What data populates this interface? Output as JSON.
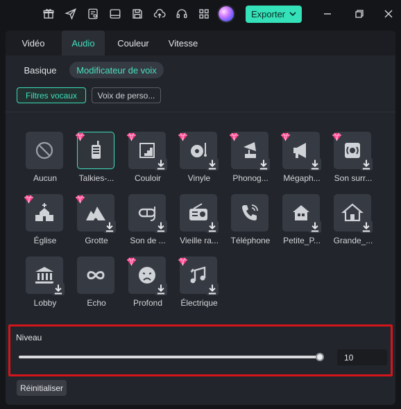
{
  "topbar": {
    "icons": [
      "gift-icon",
      "send-icon",
      "checklist-icon",
      "layout-icon",
      "save-icon",
      "cloud-upload-icon",
      "headset-icon",
      "grid-icon"
    ],
    "export_label": "Exporter"
  },
  "tabs": [
    {
      "label": "Vidéo",
      "active": false
    },
    {
      "label": "Audio",
      "active": true
    },
    {
      "label": "Couleur",
      "active": false
    },
    {
      "label": "Vitesse",
      "active": false
    }
  ],
  "subtabs": [
    {
      "label": "Basique",
      "active": false
    },
    {
      "label": "Modificateur de voix",
      "active": true
    }
  ],
  "chips": [
    {
      "label": "Filtres vocaux",
      "active": true
    },
    {
      "label": "Voix de perso...",
      "active": false
    }
  ],
  "effects": [
    {
      "label": "Aucun",
      "icon": "none-icon",
      "premium": false,
      "download": false,
      "selected": false
    },
    {
      "label": "Talkies-...",
      "icon": "walkie-talkie-icon",
      "premium": true,
      "download": false,
      "selected": true
    },
    {
      "label": "Couloir",
      "icon": "stairs-icon",
      "premium": true,
      "download": true,
      "selected": false
    },
    {
      "label": "Vinyle",
      "icon": "turntable-icon",
      "premium": true,
      "download": true,
      "selected": false
    },
    {
      "label": "Phonog...",
      "icon": "phonograph-icon",
      "premium": true,
      "download": true,
      "selected": false
    },
    {
      "label": "Mégaph...",
      "icon": "megaphone-icon",
      "premium": true,
      "download": true,
      "selected": false
    },
    {
      "label": "Son surr...",
      "icon": "surround-speaker-icon",
      "premium": true,
      "download": true,
      "selected": false
    },
    {
      "label": "Église",
      "icon": "church-icon",
      "premium": true,
      "download": false,
      "selected": false
    },
    {
      "label": "Grotte",
      "icon": "cave-icon",
      "premium": true,
      "download": true,
      "selected": false
    },
    {
      "label": "Son de ...",
      "icon": "diving-mask-icon",
      "premium": false,
      "download": true,
      "selected": false
    },
    {
      "label": "Vieille ra...",
      "icon": "old-radio-icon",
      "premium": false,
      "download": true,
      "selected": false
    },
    {
      "label": "Téléphone",
      "icon": "phone-icon",
      "premium": false,
      "download": false,
      "selected": false
    },
    {
      "label": "Petite_P...",
      "icon": "small-house-icon",
      "premium": false,
      "download": true,
      "selected": false
    },
    {
      "label": "Grande_...",
      "icon": "large-house-icon",
      "premium": false,
      "download": true,
      "selected": false
    },
    {
      "label": "Lobby",
      "icon": "bank-building-icon",
      "premium": false,
      "download": true,
      "selected": false
    },
    {
      "label": "Echo",
      "icon": "infinity-icon",
      "premium": false,
      "download": false,
      "selected": false
    },
    {
      "label": "Profond",
      "icon": "sad-face-icon",
      "premium": true,
      "download": true,
      "selected": false
    },
    {
      "label": "Électrique",
      "icon": "music-note-icon",
      "premium": true,
      "download": true,
      "selected": false
    }
  ],
  "level": {
    "title": "Niveau",
    "value": "10",
    "fraction": 1.0
  },
  "reset_label": "Réinitialiser",
  "colors": {
    "accent": "#3fe0bd",
    "highlight_border": "#d4151b",
    "premium_gem": "#ff3d8b"
  }
}
